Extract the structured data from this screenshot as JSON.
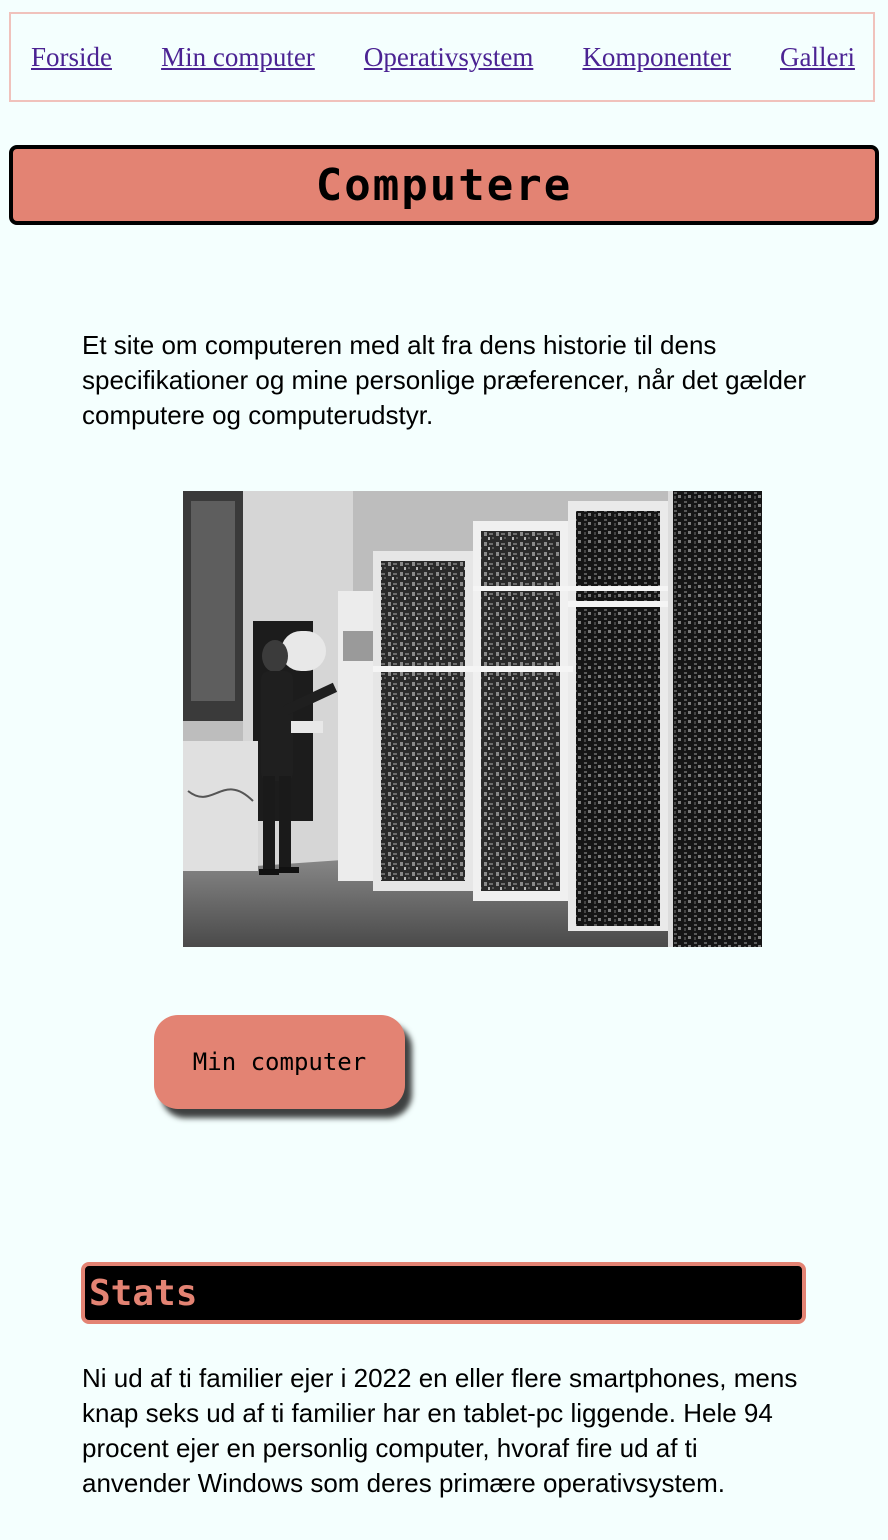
{
  "nav": {
    "items": [
      "Forside",
      "Min computer",
      "Operativsystem",
      "Komponenter",
      "Galleri"
    ]
  },
  "header": {
    "title": "Computere"
  },
  "intro": "Et site om computeren med alt fra dens historie til dens specifikationer og mine personlige præferencer, når det gælder computere og computerudstyr.",
  "cta": {
    "label": "Min computer"
  },
  "stats": {
    "heading": "Stats",
    "text": "Ni ud af ti familier ejer i 2022 en eller flere smartphones, mens knap seks ud af ti familier har en tablet-pc liggende. Hele 94 procent ejer en personlig computer, hvoraf fire ud af ti anvender Windows som deres primære operativsystem."
  },
  "colors": {
    "background": "#f4fffe",
    "accent": "#e38373",
    "nav_border": "#f0c2bc",
    "link": "#4b2393"
  }
}
